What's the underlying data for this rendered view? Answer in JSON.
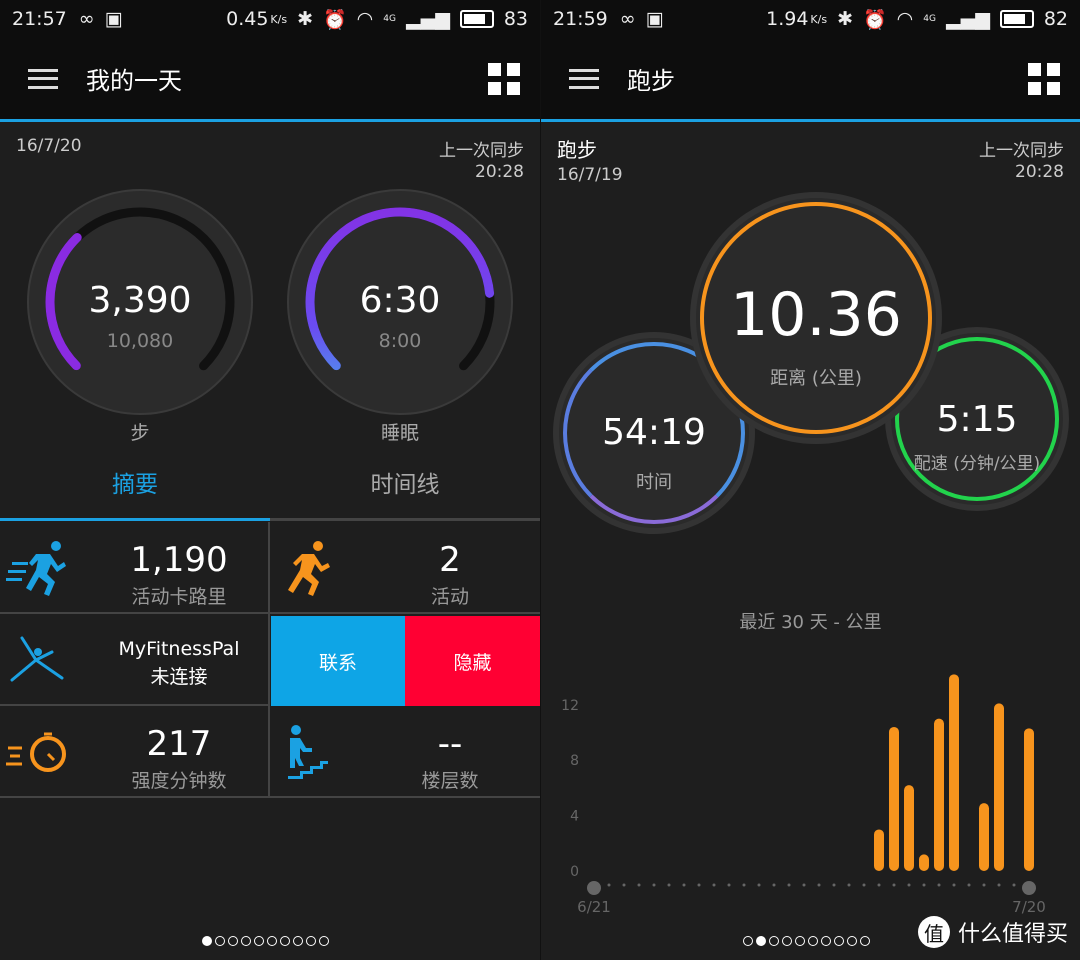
{
  "left": {
    "status": {
      "time": "21:57",
      "speed": "0.45",
      "speed_unit": "K/s",
      "network": "4G",
      "battery": "83"
    },
    "title": "我的一天",
    "date": "16/7/20",
    "sync_label": "上一次同步",
    "sync_time": "20:28",
    "steps": {
      "value": "3,390",
      "goal": "10,080",
      "label": "步",
      "progress": 0.336,
      "color": "#8a2be2"
    },
    "sleep": {
      "value": "6:30",
      "goal": "8:00",
      "label": "睡眠",
      "progress": 0.8125
    },
    "tabs": [
      {
        "label": "摘要",
        "active": true
      },
      {
        "label": "时间线",
        "active": false
      }
    ],
    "tiles": {
      "calories": {
        "value": "1,190",
        "label": "活动卡路里"
      },
      "activities": {
        "value": "2",
        "label": "活动"
      },
      "mfp": {
        "name": "MyFitnessPal",
        "status": "未连接",
        "connect": "联系",
        "hide": "隐藏"
      },
      "intensity": {
        "value": "217",
        "label": "强度分钟数"
      },
      "floors": {
        "value": "--",
        "label": "楼层数"
      }
    },
    "page_index": 0,
    "page_count": 10
  },
  "right": {
    "status": {
      "time": "21:59",
      "speed": "1.94",
      "speed_unit": "K/s",
      "network": "4G",
      "battery": "82"
    },
    "title": "跑步",
    "activity": "跑步",
    "date": "16/7/19",
    "sync_label": "上一次同步",
    "sync_time": "20:28",
    "distance": {
      "value": "10.36",
      "label": "距离 (公里)",
      "color": "#f7941d"
    },
    "time": {
      "value": "54:19",
      "label": "时间"
    },
    "pace": {
      "value": "5:15",
      "label": "配速 (分钟/公里)",
      "color": "#22d34c"
    },
    "page_index": 1,
    "page_count": 10,
    "watermark": "什么值得买"
  },
  "chart_data": {
    "type": "bar",
    "title": "最近 30 天 - 公里",
    "x_start": "6/21",
    "x_end": "7/20",
    "days": 30,
    "yticks": [
      0,
      4,
      8,
      12
    ],
    "ylim": [
      0,
      14.5
    ],
    "grid": false,
    "color": "#f7941d",
    "values": [
      0,
      0,
      0,
      0,
      0,
      0,
      0,
      0,
      0,
      0,
      0,
      0,
      0,
      0,
      0,
      0,
      0,
      0,
      0,
      3.0,
      10.4,
      6.2,
      1.2,
      11.0,
      14.2,
      0,
      4.9,
      12.1,
      0,
      10.3
    ]
  }
}
